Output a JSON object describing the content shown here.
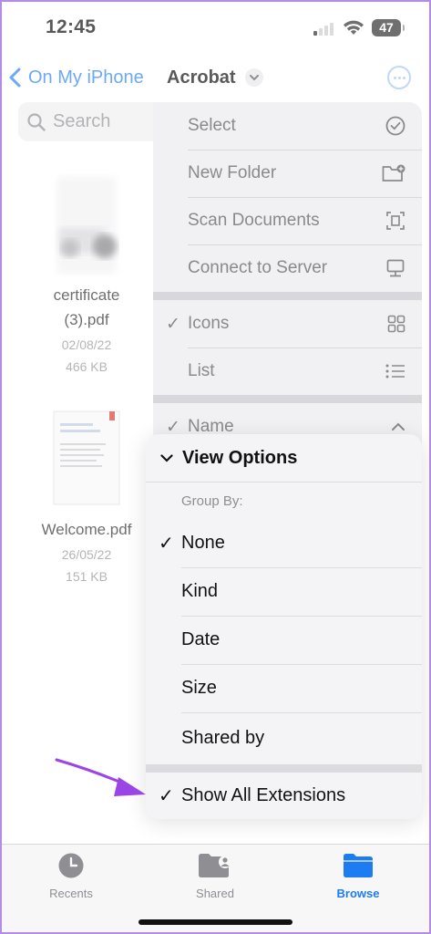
{
  "status_bar": {
    "time": "12:45",
    "battery": "47"
  },
  "nav": {
    "back_label": "On My iPhone",
    "title": "Acrobat"
  },
  "search": {
    "placeholder": "Search"
  },
  "files": [
    {
      "name_line1": "certificate",
      "name_line2": "(3).pdf",
      "date": "02/08/22",
      "size": "466 KB"
    },
    {
      "name_line1": "Welcome.pdf",
      "date": "26/05/22",
      "size": "151 KB"
    }
  ],
  "menu": {
    "select": "Select",
    "new_folder": "New Folder",
    "scan_documents": "Scan Documents",
    "connect_to_server": "Connect to Server",
    "icons": "Icons",
    "list": "List",
    "name": "Name"
  },
  "view_options": {
    "title": "View Options",
    "group_by_label": "Group By:",
    "options": [
      "None",
      "Kind",
      "Date",
      "Size",
      "Shared by"
    ],
    "selected_option": "None",
    "show_all_extensions": "Show All Extensions"
  },
  "tabs": [
    {
      "label": "Recents",
      "icon": "clock-icon"
    },
    {
      "label": "Shared",
      "icon": "shared-folder-icon"
    },
    {
      "label": "Browse",
      "icon": "folder-icon",
      "active": true
    }
  ],
  "colors": {
    "accent": "#1d7cf2",
    "arrow": "#9b45e6",
    "frame": "#b48be6"
  }
}
